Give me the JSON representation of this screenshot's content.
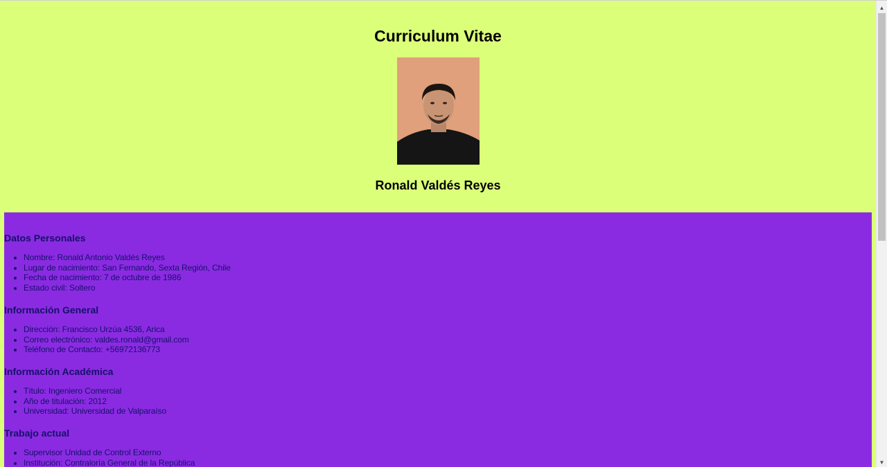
{
  "header": {
    "title": "Curriculum Vitae",
    "name": "Ronald Valdés Reyes"
  },
  "sections": [
    {
      "title": "Datos Personales",
      "items": [
        "Nombre: Ronald Antonio Valdés Reyes",
        "Lugar de nacimiento: San Fernando, Sexta Región, Chile",
        "Fecha de nacimiento: 7 de octubre de 1986",
        "Estado civil: Soltero"
      ]
    },
    {
      "title": "Información General",
      "items": [
        "Dirección: Francisco Urzúa 4536, Arica",
        "Correo electrónico: valdes.ronald@gmail.com",
        "Teléfono de Contacto: +56972136773"
      ]
    },
    {
      "title": "Información Académica",
      "items": [
        "Título: Ingeniero Comercial",
        "Año de titulación: 2012",
        "Universidad: Universidad de Valparaíso"
      ]
    },
    {
      "title": "Trabajo actual",
      "items": [
        "Supervisor Unidad de Control Externo",
        "Institución: Contraloría General de la República"
      ]
    }
  ],
  "colors": {
    "header_bg": "#dcff7a",
    "content_bg": "#8a2be2",
    "content_text": "#17106b"
  },
  "scrollbar": {
    "up_icon": "triangle-up-icon",
    "down_icon": "triangle-down-icon"
  }
}
